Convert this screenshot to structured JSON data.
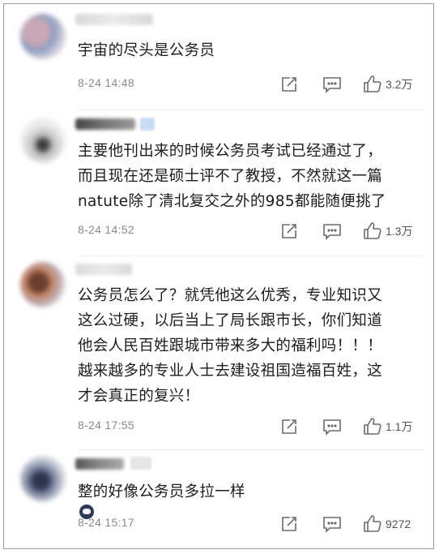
{
  "comments": [
    {
      "text_lines": [
        "宇宙的尽头是公务员"
      ],
      "time": "8-24 14:48",
      "likes": "3.2万"
    },
    {
      "text_lines": [
        "主要他刊出来的时候公务员考试已经通过了，",
        "而且现在还是硕士评不了教授，不然就这一篇",
        "natute除了清北复交之外的985都能随便挑了"
      ],
      "time": "8-24 14:52",
      "likes": "1.3万"
    },
    {
      "text_lines": [
        "公务员怎么了？就凭他这么优秀，专业知识又",
        "这么过硬，以后当上了局长跟市长，你们知道",
        "他会人民百姓跟城市带来多大的福利吗！！！",
        "越来越多的专业人士去建设祖国造福百姓，这",
        "才会真正的复兴！"
      ],
      "time": "8-24 17:55",
      "likes": "1.1万"
    },
    {
      "text_lines": [
        "整的好像公务员多拉一样"
      ],
      "time": "8-24 15:17",
      "likes": "9272",
      "emoji": "grimace-emoji"
    }
  ],
  "icons": {
    "share": "share-icon",
    "reply": "comment-icon",
    "like": "thumbs-up-icon"
  },
  "colors": {
    "text": "#1c1c1c",
    "meta": "#8a8a8a",
    "icon": "#6b6b6b"
  }
}
